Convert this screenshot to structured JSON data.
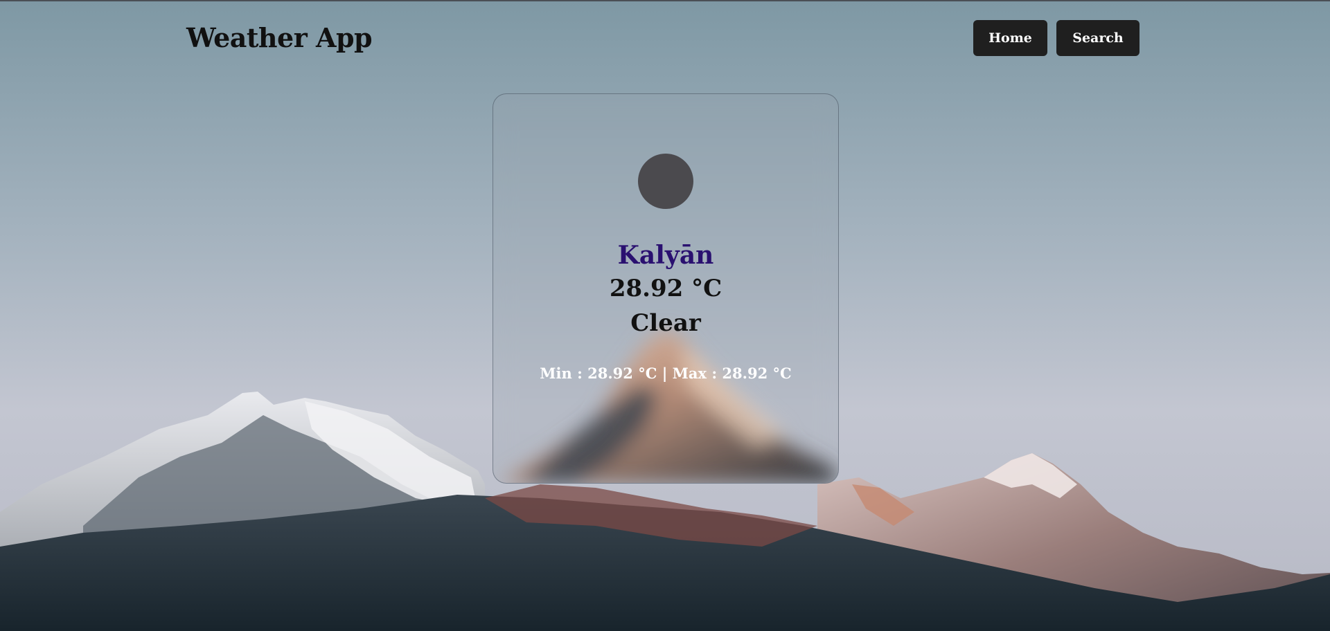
{
  "app": {
    "title": "Weather App"
  },
  "nav": {
    "home_label": "Home",
    "search_label": "Search"
  },
  "weather": {
    "city": "Kalyān",
    "temperature": "28.92 °C",
    "condition": "Clear",
    "min_max": "Min : 28.92 °C | Max : 28.92 °C"
  },
  "colors": {
    "city_text": "#2a1070",
    "button_bg": "#1f1f1f",
    "button_text": "#ffffff",
    "icon_placeholder": "#4b4a4e"
  },
  "icons": {
    "weather_icon": "weather-icon-placeholder"
  }
}
